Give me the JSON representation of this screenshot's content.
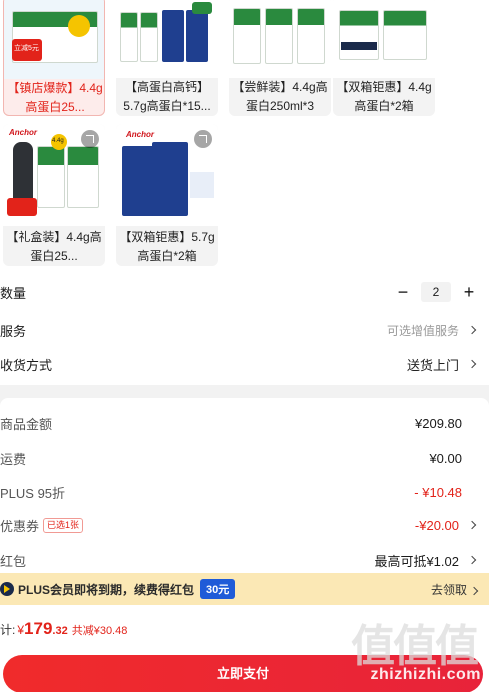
{
  "products": [
    {
      "label": "【镇店爆款】4.4g高蛋白25...",
      "selected": true
    },
    {
      "label": "【高蛋白高钙】5.7g高蛋白*15..."
    },
    {
      "label": "【尝鲜装】4.4g高蛋白250ml*3"
    },
    {
      "label": "【双箱钜惠】4.4g高蛋白*2箱"
    },
    {
      "label": "【礼盒装】4.4g高蛋白25..."
    },
    {
      "label": "【双箱钜惠】5.7g高蛋白*2箱"
    }
  ],
  "img_text": {
    "p1_price": "立减5元",
    "p1_top": "入会",
    "p1_badge": "1元购",
    "p5_pct": "4.4g",
    "p5_sub": "15支",
    "brand": "Anchor"
  },
  "quantity": {
    "label": "数量",
    "minus": "−",
    "value": "2",
    "plus": "+"
  },
  "service": {
    "label": "服务",
    "value": "可选增值服务"
  },
  "delivery": {
    "label": "收货方式",
    "value": "送货上门"
  },
  "price": {
    "goods_label": "商品金额",
    "goods_value": "¥209.80",
    "freight_label": "运费",
    "freight_value": "¥0.00",
    "plus_label": "PLUS 95折",
    "plus_value": "- ¥10.48",
    "coupon_label": "优惠券",
    "coupon_tag": "已选1张",
    "coupon_value": "-¥20.00",
    "redpack_label": "红包",
    "redpack_value": "最高可抵¥1.02"
  },
  "member_bar": {
    "text": "PLUS会员即将到期，续费得红包",
    "chip": "30元",
    "action": "去领取"
  },
  "total": {
    "prefix": "计:",
    "currency": "¥",
    "int": "179",
    "dec": ".32",
    "saved": "共减¥30.48"
  },
  "pay_button": "立即支付",
  "watermark": "zhizhizhi.com",
  "watermark_logo": "值值值",
  "colors": {
    "accent": "#e2231a",
    "member_bar": "#fbe8b5",
    "chip": "#1f5bd8"
  }
}
